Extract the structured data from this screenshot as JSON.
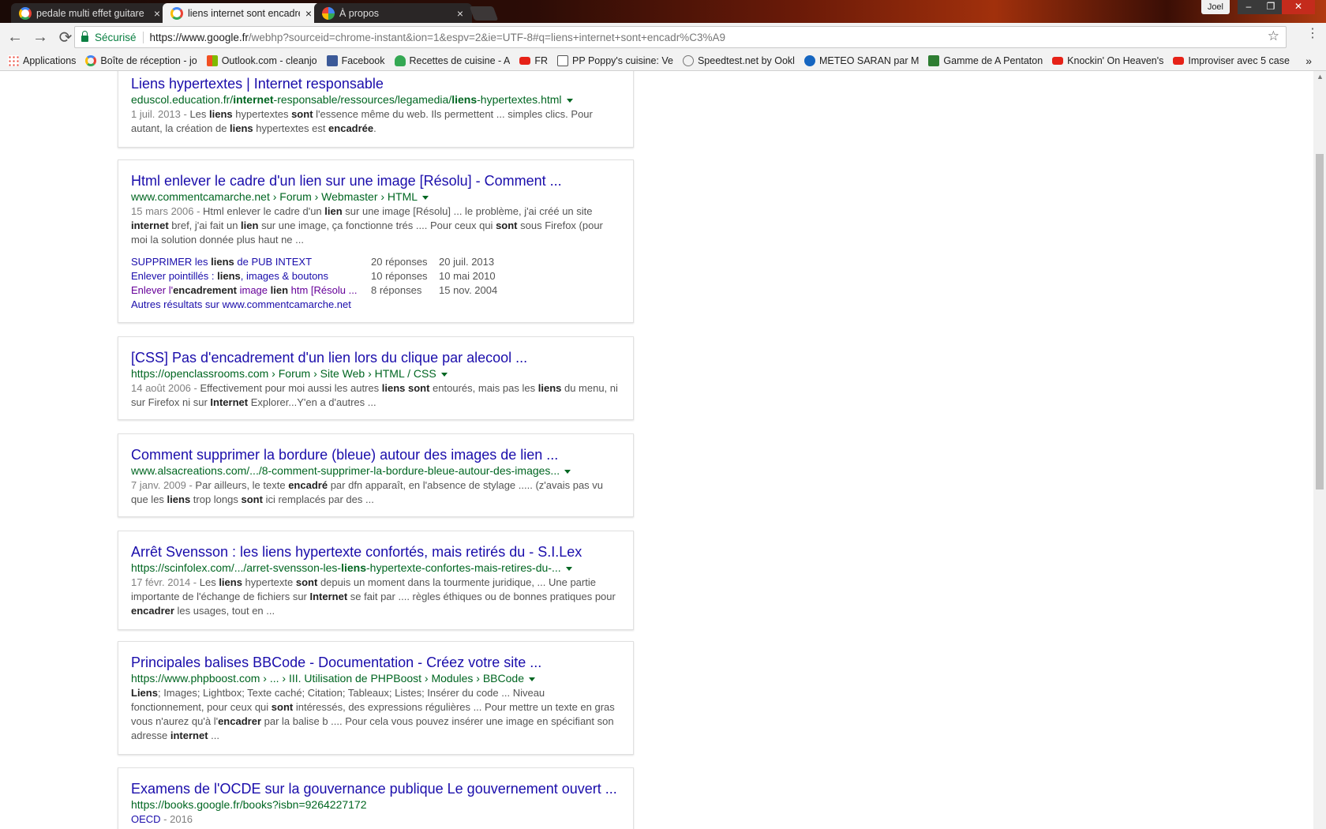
{
  "tabs": [
    {
      "title": "pedale multi effet guitare",
      "close": "×"
    },
    {
      "title": "liens internet sont encadrés",
      "close": "×"
    },
    {
      "title": "À propos",
      "close": "×"
    }
  ],
  "window": {
    "user": "Joel",
    "minimize": "–",
    "maximize": "❐",
    "close": "✕"
  },
  "toolbar": {
    "back": "←",
    "forward": "→",
    "reload": "⟳",
    "secure_label": "Sécurisé",
    "url_host": "https://www.google.fr",
    "url_rest": "/webhp?sourceid=chrome-instant&ion=1&espv=2&ie=UTF-8#q=liens+internet+sont+encadr%C3%A9",
    "star": "☆",
    "menu": "⋮"
  },
  "bookmarks": [
    {
      "label": "Applications",
      "icon": "apps-icon"
    },
    {
      "label": "Boîte de réception - jo",
      "icon": "google-icon"
    },
    {
      "label": "Outlook.com - cleanjo",
      "icon": "outlook-icon"
    },
    {
      "label": "Facebook",
      "icon": "facebook-icon"
    },
    {
      "label": "Recettes de cuisine - A",
      "icon": "heart-icon"
    },
    {
      "label": "FR",
      "icon": "youtube-icon"
    },
    {
      "label": "PP Poppy's cuisine: Ve",
      "icon": "document-icon"
    },
    {
      "label": "Speedtest.net by Ookl",
      "icon": "speedtest-icon"
    },
    {
      "label": "METEO SARAN par M",
      "icon": "meteo-icon"
    },
    {
      "label": "Gamme de A Pentaton",
      "icon": "gamme-icon"
    },
    {
      "label": "Knockin' On Heaven's",
      "icon": "youtube-icon"
    },
    {
      "label": "Improviser avec 5 case",
      "icon": "youtube-icon"
    }
  ],
  "bookmarks_more": "»",
  "results": {
    "r1": {
      "title": "Liens hypertextes | Internet responsable",
      "url_a": "eduscol.education.fr/",
      "url_b": "internet",
      "url_c": "-responsable/ressources/legamedia/",
      "url_d": "liens",
      "url_e": "-hypertextes.html",
      "s1": "1 juil. 2013 - ",
      "s2": "Les ",
      "s3": "liens",
      "s4": " hypertextes ",
      "s5": "sont",
      "s6": " l'essence même du web. Ils permettent ... simples clics. Pour autant, la création de ",
      "s7": "liens",
      "s8": " hypertextes est ",
      "s9": "encadrée",
      "s10": "."
    },
    "r2": {
      "title": "Html enlever le cadre d'un lien sur une image [Résolu] - Comment ...",
      "url": "www.commentcamarche.net › Forum › Webmaster › HTML",
      "s1": "15 mars 2006 - ",
      "s2": "Html enlever le cadre d'un ",
      "s3": "lien",
      "s4": " sur une image [Résolu] ... le problème, j'ai créé un site ",
      "s5": "internet",
      "s6": " bref, j'ai fait un ",
      "s7": "lien",
      "s8": " sur une image, ça fonctionne trés .... Pour ceux qui ",
      "s9": "sont",
      "s10": " sous Firefox (pour moi la solution donnée plus haut ne ...",
      "sub": [
        {
          "a": "SUPPRIMER les ",
          "b": "liens",
          "c": " de PUB INTEXT",
          "count": "20 réponses",
          "date": "20 juil. 2013"
        },
        {
          "a": "Enlever pointillés : ",
          "b": "liens",
          "c": ", images & boutons",
          "count": "10 réponses",
          "date": "10 mai 2010"
        },
        {
          "a": "Enlever l'",
          "b": "encadrement",
          "c": " image ",
          "d": "lien",
          "e": " htm [Résolu ...",
          "count": "8 réponses",
          "date": "15 nov. 2004"
        }
      ],
      "more": "Autres résultats sur www.commentcamarche.net"
    },
    "r3": {
      "title": "[CSS] Pas d'encadrement d'un lien lors du clique par alecool ...",
      "url": "https://openclassrooms.com › Forum › Site Web › HTML / CSS",
      "s1": "14 août 2006 - ",
      "s2": "Effectivement pour moi aussi les autres ",
      "s3": "liens",
      "s4": " ",
      "s5": "sont",
      "s6": " entourés, mais pas les ",
      "s7": "liens",
      "s8": " du menu, ni sur Firefox ni sur ",
      "s9": "Internet",
      "s10": " Explorer...Y'en a d'autres ..."
    },
    "r4": {
      "title": "Comment supprimer la bordure (bleue) autour des images de lien ...",
      "url": "www.alsacreations.com/.../8-comment-supprimer-la-bordure-bleue-autour-des-images...",
      "s1": "7 janv. 2009 - ",
      "s2": "Par ailleurs, le texte ",
      "s3": "encadré",
      "s4": " par dfn apparaît, en l'absence de stylage ..... (z'avais pas vu que les ",
      "s5": "liens",
      "s6": " trop longs ",
      "s7": "sont",
      "s8": " ici remplacés par des ..."
    },
    "r5": {
      "title": "Arrêt Svensson : les liens hypertexte confortés, mais retirés du - S.I.Lex",
      "url_a": "https://scinfolex.com/.../arret-svensson-les-",
      "url_b": "liens",
      "url_c": "-hypertexte-confortes-mais-retires-du-...",
      "s1": "17 févr. 2014 - ",
      "s2": "Les ",
      "s3": "liens",
      "s4": " hypertexte ",
      "s5": "sont",
      "s6": " depuis un moment dans la tourmente juridique, ... Une partie importante de l'échange de fichiers sur ",
      "s7": "Internet",
      "s8": " se fait par .... règles éthiques ou de bonnes pratiques pour ",
      "s9": "encadrer",
      "s10": " les usages, tout en ..."
    },
    "r6": {
      "title": "Principales balises BBCode - Documentation - Créez votre site ...",
      "url": "https://www.phpboost.com › ... › III. Utilisation de PHPBoost › Modules › BBCode",
      "s1": "Liens",
      "s2": "; Images; Lightbox; Texte caché; Citation; Tableaux; Listes; Insérer du code ... Niveau fonctionnement, pour ceux qui ",
      "s3": "sont",
      "s4": " intéressés, des expressions régulières ... Pour mettre un texte en gras vous n'aurez qu'à l'",
      "s5": "encadrer",
      "s6": " par la balise b .... Pour cela vous pouvez insérer une image en spécifiant son adresse ",
      "s7": "internet",
      "s8": " ..."
    },
    "r7": {
      "title": "Examens de l'OCDE sur la gouvernance publique Le gouvernement ouvert ...",
      "url": "https://books.google.fr/books?isbn=9264227172",
      "author": "OECD",
      "year": " - 2016"
    }
  }
}
